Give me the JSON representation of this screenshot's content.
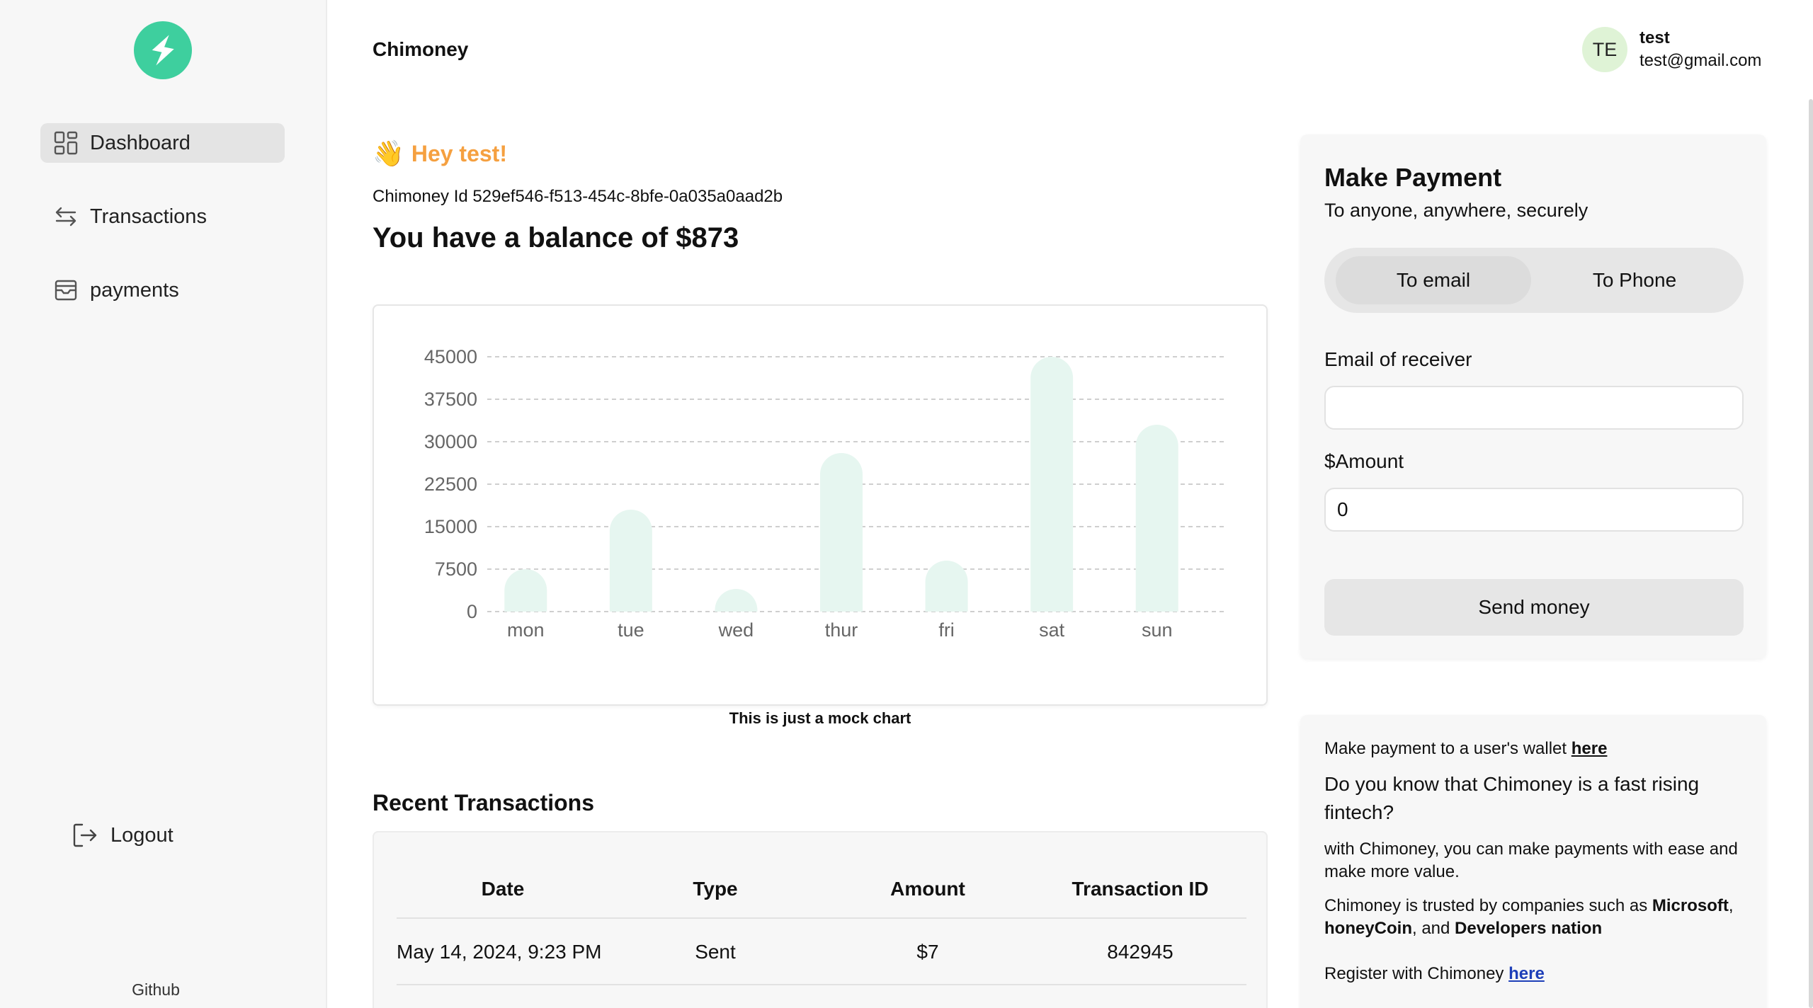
{
  "header": {
    "brand": "Chimoney",
    "avatar_initials": "TE",
    "user_name": "test",
    "user_email": "test@gmail.com"
  },
  "sidebar": {
    "items": [
      {
        "label": "Dashboard",
        "icon": "grid-icon",
        "active": true
      },
      {
        "label": "Transactions",
        "icon": "arrows-swap-icon",
        "active": false
      },
      {
        "label": "payments",
        "icon": "inbox-icon",
        "active": false
      }
    ],
    "logout_label": "Logout",
    "github_label": "Github",
    "logo_icon": "lightning-bolt-icon",
    "logo_color": "#3ecf9e"
  },
  "main": {
    "greeting_emoji": "👋",
    "greeting": "Hey test!",
    "chimoney_id": "Chimoney Id 529ef546-f513-454c-8bfe-0a035a0aad2b",
    "balance_text": "You have a balance of $873",
    "chart_note": "This is just a mock chart",
    "recent_title": "Recent Transactions"
  },
  "chart_data": {
    "type": "bar",
    "categories": [
      "mon",
      "tue",
      "wed",
      "thur",
      "fri",
      "sat",
      "sun"
    ],
    "values": [
      7500,
      18000,
      4000,
      28000,
      9000,
      45000,
      33000
    ],
    "yticks": [
      "0",
      "7500",
      "15000",
      "22500",
      "30000",
      "37500",
      "45000"
    ],
    "ylim": [
      0,
      45000
    ],
    "grid": true,
    "bar_color": "#e6f6f0"
  },
  "transactions": {
    "columns": [
      "Date",
      "Type",
      "Amount",
      "Transaction ID"
    ],
    "rows": [
      {
        "date": "May 14, 2024, 9:23 PM",
        "type": "Sent",
        "amount": "$7",
        "id": "842945"
      }
    ]
  },
  "payment": {
    "title": "Make Payment",
    "subtitle": "To anyone, anywhere, securely",
    "tab_email": "To email",
    "tab_phone": "To Phone",
    "email_label": "Email of receiver",
    "email_value": "",
    "amount_label": "$Amount",
    "amount_value": "0",
    "send_label": "Send money"
  },
  "info": {
    "wallet_text": "Make payment to a user's wallet ",
    "wallet_link": "here",
    "question": "Do you know that Chimoney is a fast rising fintech?",
    "ease_text": "with Chimoney, you can make payments with ease and make more value.",
    "trusted_text": "Chimoney is trusted by companies such as ",
    "company1": "Microsoft",
    "company2": "honeyCoin",
    "and_text": ", and ",
    "company3": "Developers nation",
    "register_text": "Register with Chimoney ",
    "register_link": "here"
  }
}
